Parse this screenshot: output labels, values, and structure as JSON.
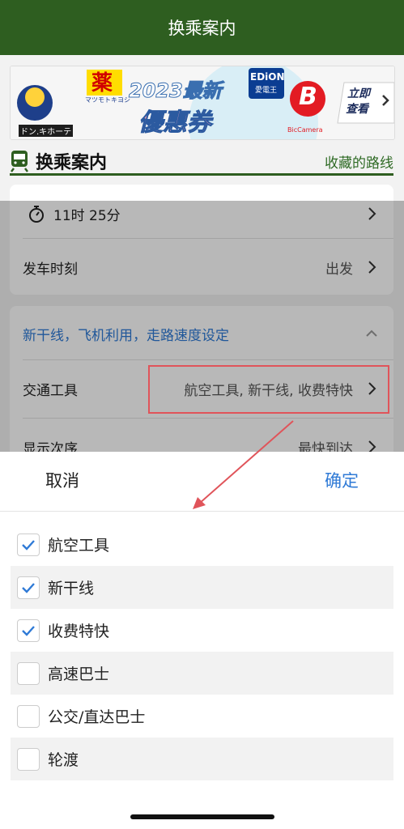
{
  "topbar": {
    "title": "换乘案内"
  },
  "banner": {
    "brand_left": "ドン.キホーテ",
    "kusuri": "薬",
    "kusuri_sub": "マツモトキヨシ",
    "promo_year": "2023最新",
    "promo_title": "優惠券",
    "edion": "EDiON",
    "edion_sub": "愛電王",
    "bic_letter": "B",
    "bic_sub": "BicCamera",
    "cta_line1": "立即",
    "cta_line2": "查看"
  },
  "header": {
    "title": "换乘案内",
    "link": "收藏的路线"
  },
  "settings": {
    "time_label": "11时 25分",
    "depart_label": "发车时刻",
    "depart_value": "出发",
    "section_title": "新干线，飞机利用，走路速度设定",
    "transport_label": "交通工具",
    "transport_value": "航空工具, 新干线, 收费特快",
    "order_label": "显示次序",
    "order_value": "最快到达"
  },
  "sheet": {
    "cancel": "取消",
    "confirm": "确定",
    "options": [
      {
        "label": "航空工具",
        "checked": true
      },
      {
        "label": "新干线",
        "checked": true
      },
      {
        "label": "收费特快",
        "checked": true
      },
      {
        "label": "高速巴士",
        "checked": false
      },
      {
        "label": "公交/直达巴士",
        "checked": false
      },
      {
        "label": "轮渡",
        "checked": false
      }
    ]
  },
  "colors": {
    "brand_green": "#2e5e20",
    "accent_blue": "#2f7ad6",
    "highlight_red": "#e0545a"
  }
}
